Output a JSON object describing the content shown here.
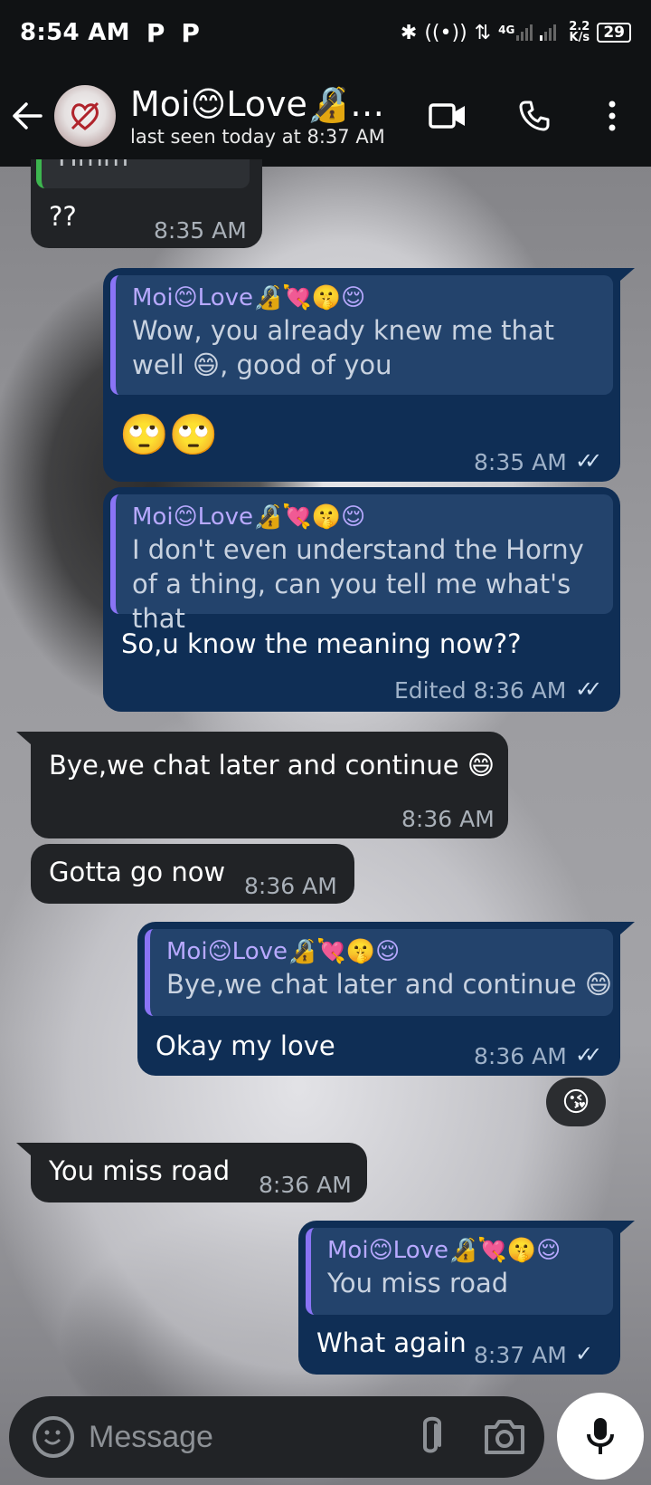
{
  "status_bar": {
    "time": "8:54 AM",
    "notif_icons": [
      "P",
      "P"
    ],
    "network": "4G",
    "speed_value": "2.2",
    "speed_unit": "K/s",
    "battery": "29"
  },
  "header": {
    "contact_name": "Moi😊Love🔏…",
    "last_seen": "last seen today at 8:37 AM"
  },
  "messages": [
    {
      "partial_text": "Hmm",
      "text": "??",
      "time": "8:35 AM"
    },
    {
      "quote_name": "Moi😊Love🔏💘🤫😌",
      "quote_text": "Wow, you already knew me that well 😄, good of you",
      "text": "🙄🙄",
      "time": "8:35 AM"
    },
    {
      "quote_name": "Moi😊Love🔏💘🤫😌",
      "quote_text": "I don't even understand the Horny of a thing, can you tell me what's that",
      "text": "So,u know the meaning now??",
      "time": "Edited 8:36 AM"
    },
    {
      "text": "Bye,we chat later and continue 😄",
      "time": "8:36 AM"
    },
    {
      "text": "Gotta go now",
      "time": "8:36 AM"
    },
    {
      "quote_name": "Moi😊Love🔏💘🤫😌",
      "quote_text": "Bye,we chat later and continue 😄",
      "text": "Okay my love",
      "time": "8:36 AM",
      "reaction": "😘"
    },
    {
      "text": "You miss road",
      "time": "8:36 AM"
    },
    {
      "quote_name": "Moi😊Love🔏💘🤫😌",
      "quote_text": "You miss road",
      "text": "What again",
      "time": "8:37 AM"
    }
  ],
  "composer": {
    "placeholder": "Message"
  },
  "colors": {
    "outgoing_bubble": "#0f2e55",
    "incoming_bubble": "#212326",
    "quote_accent": "#8a74f5",
    "top_bar": "#101214"
  }
}
